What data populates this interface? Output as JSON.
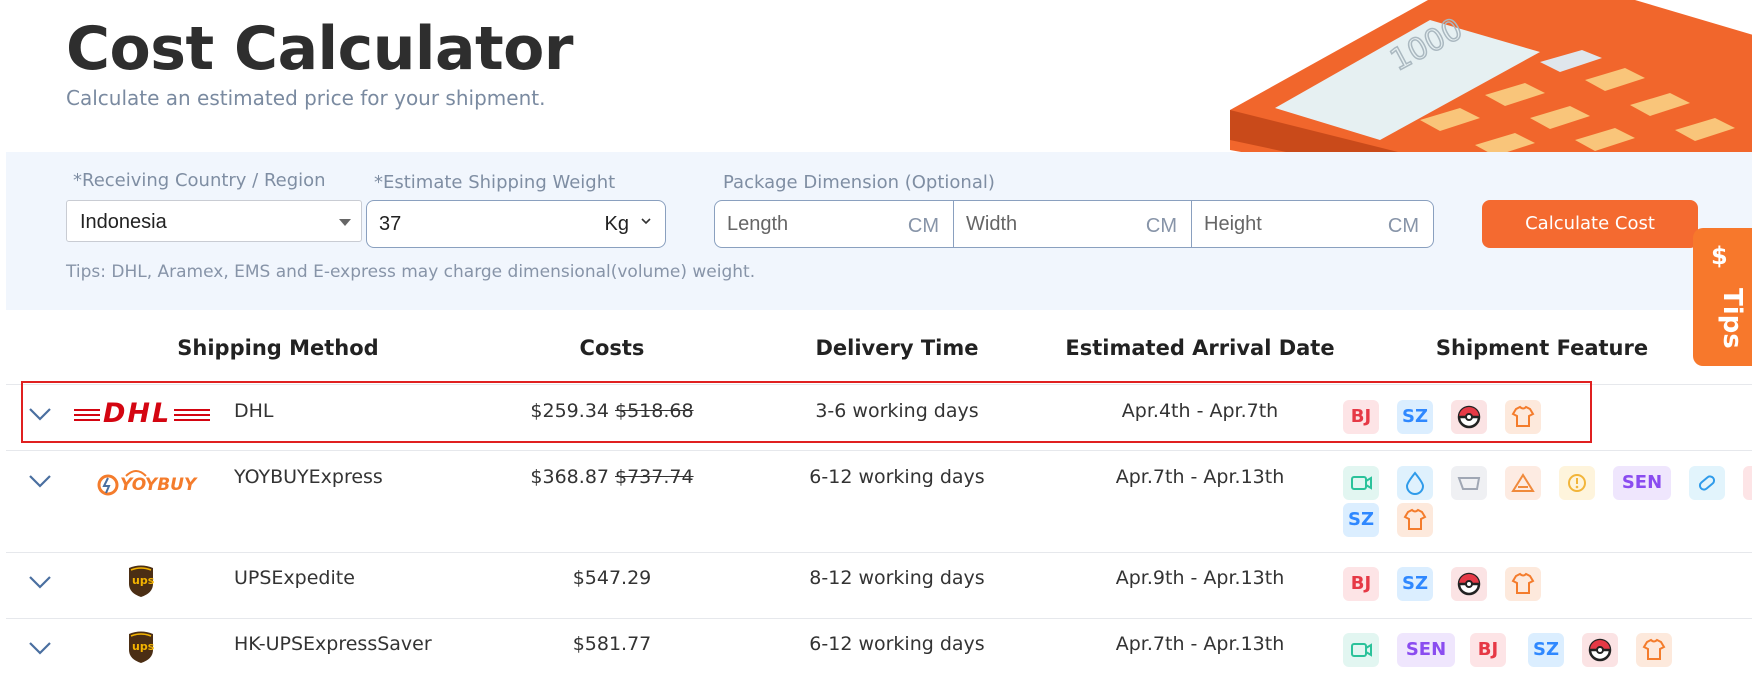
{
  "header": {
    "title": "Cost Calculator",
    "subtitle": "Calculate an estimated price for your shipment.",
    "illustration_screen_text": "1000"
  },
  "form": {
    "country_label": "*Receiving Country / Region",
    "country_value": "Indonesia",
    "weight_label": "*Estimate Shipping Weight",
    "weight_value": "37",
    "weight_unit": "Kg",
    "dimension_label": "Package Dimension (Optional)",
    "length_placeholder": "Length",
    "width_placeholder": "Width",
    "height_placeholder": "Height",
    "dimension_unit": "CM",
    "calculate_label": "Calculate Cost",
    "tips": "Tips: DHL, Aramex, EMS and E-express may charge dimensional(volume) weight."
  },
  "tips_tab": {
    "symbol": "$",
    "label": "Tips"
  },
  "table": {
    "headers": [
      "Shipping Method",
      "Costs",
      "Delivery Time",
      "Estimated Arrival Date",
      "Shipment Feature"
    ],
    "rows": [
      {
        "logo_text": "DHL",
        "method": "DHL",
        "price": "$259.34",
        "original_price": "$518.68",
        "delivery": "3-6 working days",
        "arrival": "Apr.4th - Apr.7th",
        "features": [
          "BJ",
          "SZ",
          "pokeball-icon",
          "tshirt-icon"
        ]
      },
      {
        "logo_text": "YOYBUY",
        "method": "YOYBUYExpress",
        "price": "$368.87",
        "original_price": "$737.74",
        "delivery": "6-12 working days",
        "arrival": "Apr.7th - Apr.13th",
        "features": [
          "video-icon",
          "drop-icon",
          "bag-icon",
          "warning-icon",
          "alert-icon",
          "SEN",
          "pill-icon",
          "SZ",
          "tshirt-icon"
        ]
      },
      {
        "logo_text": "ups",
        "method": "UPSExpedite",
        "price": "$547.29",
        "delivery": "8-12 working days",
        "arrival": "Apr.9th - Apr.13th",
        "features": [
          "BJ",
          "SZ",
          "pokeball-icon",
          "tshirt-icon"
        ]
      },
      {
        "logo_text": "ups",
        "method": "HK-UPSExpressSaver",
        "price": "$581.77",
        "delivery": "6-12 working days",
        "arrival": "Apr.7th - Apr.13th",
        "features": [
          "video-icon",
          "SEN",
          "BJ",
          "SZ",
          "pokeball-icon",
          "tshirt-icon"
        ]
      }
    ]
  },
  "colors": {
    "accent": "#f46a30",
    "panel": "#f1f6fd",
    "highlight_border": "#e02020",
    "dhl_red": "#d40511"
  }
}
